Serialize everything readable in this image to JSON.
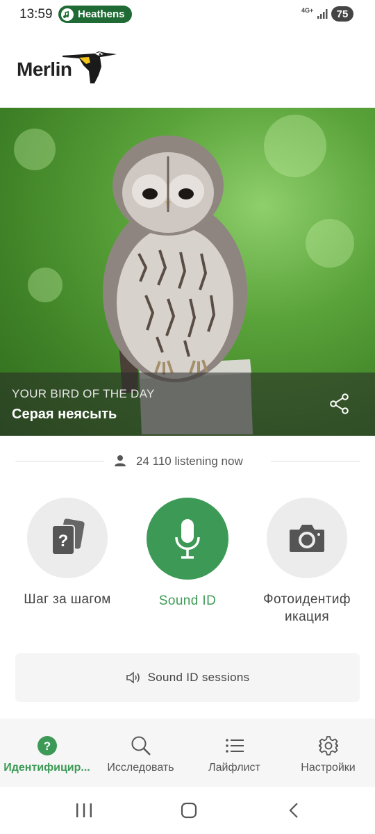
{
  "status_bar": {
    "time": "13:59",
    "media_app": "Heathens",
    "network": "4G+",
    "battery": "75"
  },
  "header": {
    "logo_text": "Merlin"
  },
  "hero": {
    "kicker": "YOUR BIRD OF THE DAY",
    "bird_name": "Серая неясыть"
  },
  "listening": {
    "text": "24 110 listening now"
  },
  "actions": [
    {
      "label": "Шаг за шагом",
      "icon": "question-cards-icon"
    },
    {
      "label": "Sound ID",
      "icon": "microphone-icon"
    },
    {
      "label": "Фотоидентиф икация",
      "icon": "camera-icon"
    }
  ],
  "sessions": {
    "label": "Sound ID sessions"
  },
  "nav": {
    "items": [
      {
        "label": "Идентифицир...",
        "icon": "help-circle-icon",
        "active": true
      },
      {
        "label": "Исследовать",
        "icon": "search-icon",
        "active": false
      },
      {
        "label": "Лайфлист",
        "icon": "list-icon",
        "active": false
      },
      {
        "label": "Настройки",
        "icon": "gear-icon",
        "active": false
      }
    ]
  },
  "colors": {
    "accent": "#3d9a56",
    "media_pill": "#1f6a35"
  }
}
